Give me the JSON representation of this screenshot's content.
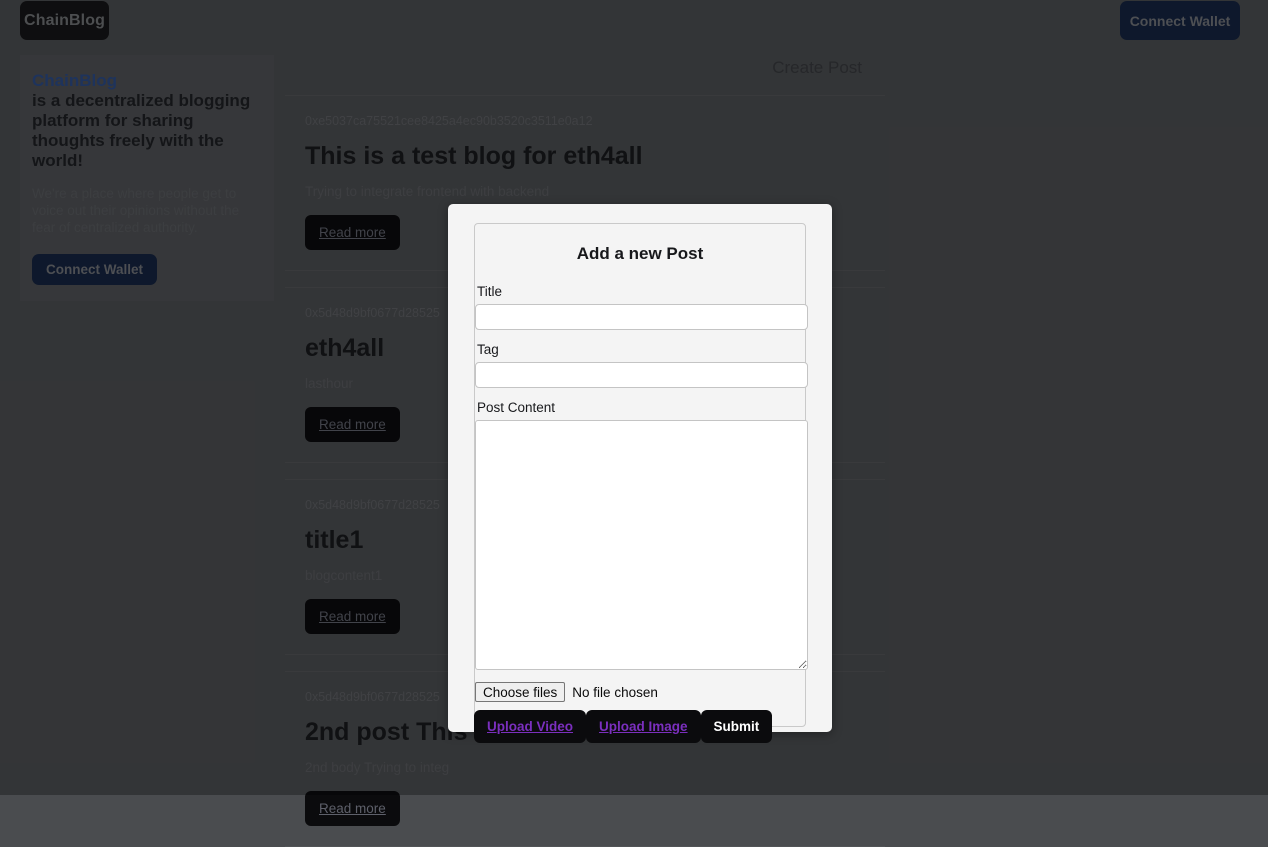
{
  "navbar": {
    "brand_label": "ChainBlog",
    "connect_label": "Connect Wallet"
  },
  "sidebar": {
    "brand_word": "ChainBlog",
    "tagline": "is a decentralized blogging platform for sharing thoughts freely with the world!",
    "description": "We're a place where people get to voice out their opinions without the fear of centralized authority.",
    "connect_label": "Connect Wallet"
  },
  "main": {
    "create_post_label": "Create Post",
    "read_more_label": "Read more",
    "posts": [
      {
        "address": "0xe5037ca75521cee8425a4ec90b3520c3511e0a12",
        "title": "This is a test blog for eth4all",
        "body": "Trying to integrate frontend with backend"
      },
      {
        "address": "0x5d48d9bf0677d28525",
        "title": "eth4all",
        "body": "lasthour"
      },
      {
        "address": "0x5d48d9bf0677d28525",
        "title": "title1",
        "body": "blogcontent1"
      },
      {
        "address": "0x5d48d9bf0677d28525",
        "title": "2nd post This",
        "body": "2nd body Trying to integ"
      }
    ]
  },
  "modal": {
    "title": "Add a new Post",
    "title_label": "Title",
    "title_value": "",
    "tag_label": "Tag",
    "tag_value": "",
    "content_label": "Post Content",
    "content_value": "",
    "file_button_label": "Choose files",
    "file_status_label": "No file chosen",
    "upload_video_label": "Upload Video",
    "upload_image_label": "Upload Image",
    "submit_label": "Submit"
  },
  "colors": {
    "page_bg": "#4a4c4f",
    "brand_blue": "#2b4a85",
    "connect_navy": "#15233f",
    "button_black": "#0b0b0d",
    "link_purple": "#7b2fbe",
    "modal_bg": "#f4f4f4"
  }
}
